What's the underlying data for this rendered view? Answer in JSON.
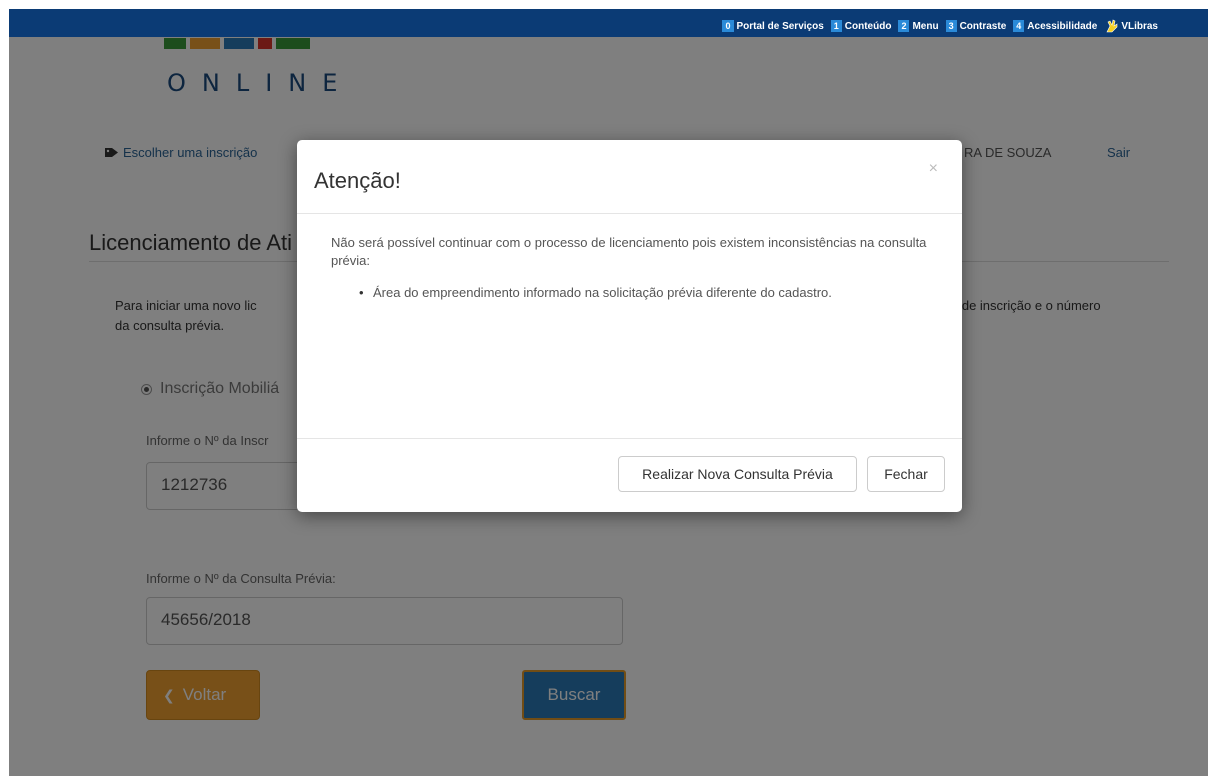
{
  "accessibility_bar": {
    "items": [
      {
        "key": "0",
        "label": "Portal de Serviços"
      },
      {
        "key": "1",
        "label": "Conteúdo"
      },
      {
        "key": "2",
        "label": "Menu"
      },
      {
        "key": "3",
        "label": "Contraste"
      },
      {
        "key": "4",
        "label": "Acessibilidade"
      }
    ],
    "vlibras_label": "VLibras"
  },
  "header": {
    "logo_text": "ONLINE",
    "choose_label": "Escolher uma inscrição",
    "user_name_fragment": "RA DE SOUZA",
    "logout_label": "Sair"
  },
  "page": {
    "title_fragment": "Licenciamento de Ati",
    "intro_left": "Para iniciar uma novo lic",
    "intro_right": "o de inscrição e o número",
    "intro_line2": "da consulta prévia.",
    "radio_label": "Inscrição Mobiliá",
    "inscricao_label": "Informe o Nº da Inscr",
    "inscricao_value": "1212736",
    "consulta_label": "Informe o Nº da Consulta Prévia:",
    "consulta_value": "45656/2018",
    "voltar_label": "Voltar",
    "buscar_label": "Buscar"
  },
  "modal": {
    "title": "Atenção!",
    "close_glyph": "×",
    "message": "Não será possível continuar com o processo de licenciamento pois existem inconsistências na consulta prévia:",
    "issues": [
      "Área do empreendimento informado na solicitação prévia diferente do cadastro."
    ],
    "btn_nova_consulta": "Realizar Nova Consulta Prévia",
    "btn_fechar": "Fechar"
  },
  "colors": {
    "topbar": "#0b3b75",
    "voltar": "#f0a030",
    "buscar": "#2a7ab8",
    "link": "#2a6496"
  }
}
